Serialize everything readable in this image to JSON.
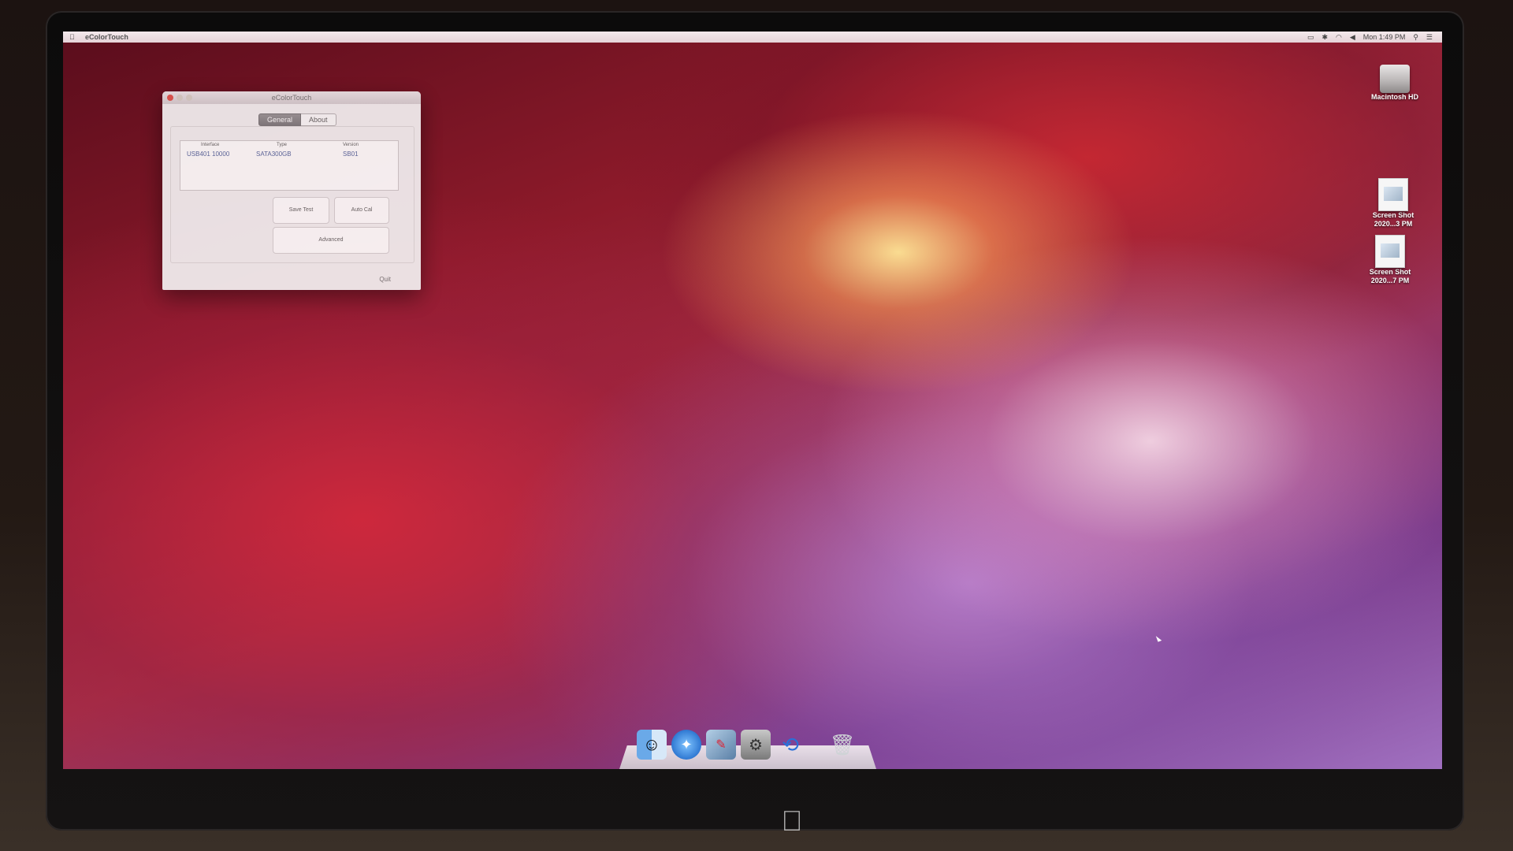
{
  "menubar": {
    "app_name": "eColorTouch",
    "clock": "Mon 1:49 PM"
  },
  "window": {
    "title": "eColorTouch",
    "tabs": [
      "General",
      "About"
    ],
    "table": {
      "headers": [
        "Interface",
        "Type",
        "Version"
      ],
      "row": [
        "USB401 10000",
        "SATA300GB",
        "SB01"
      ]
    },
    "buttons": {
      "button_a": "Save Test",
      "button_b": "Auto Cal",
      "advanced": "Advanced"
    },
    "quit_label": "Quit"
  },
  "desktop_icons": [
    {
      "label": "Macintosh HD",
      "icon": "hard-drive-icon"
    },
    {
      "label": "Screen Shot 2020...3 PM",
      "icon": "screenshot-file-icon"
    },
    {
      "label": "Screen Shot 2020...7 PM",
      "icon": "screenshot-file-icon"
    }
  ],
  "dock": {
    "items": [
      "Finder",
      "Safari",
      "Preview",
      "System Preferences",
      "Migration Assistant",
      "Trash"
    ]
  },
  "colors": {
    "menubar": "#f0e4e8",
    "window": "#f3f1f2",
    "accent_link": "#5a6aa0",
    "close_button": "#e0564e"
  }
}
